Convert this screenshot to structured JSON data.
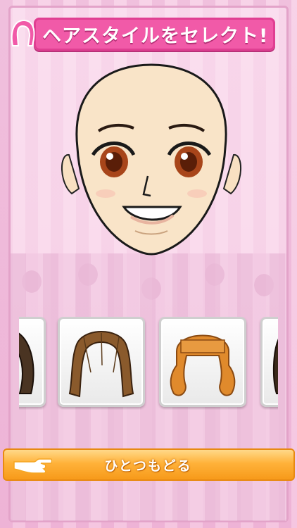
{
  "header": {
    "title": "ヘアスタイルをセレクト!",
    "icon": "hair-silhouette-icon"
  },
  "preview": {
    "subject": "bald-anime-face"
  },
  "hairstyles": [
    {
      "name": "hairstyle-dark-partial",
      "color": "#4a3422"
    },
    {
      "name": "hairstyle-brown-long",
      "color": "#8a5a2c"
    },
    {
      "name": "hairstyle-orange-curly",
      "color": "#e08a2c"
    },
    {
      "name": "hairstyle-dark-partial-right",
      "color": "#3a2a1a"
    }
  ],
  "footer": {
    "back_label": "ひとつもどる",
    "hand_icon": "pointing-hand-icon"
  },
  "colors": {
    "title_pink": "#f15aa8",
    "button_orange": "#ffb23a",
    "background_pink": "#f4c6e0"
  }
}
